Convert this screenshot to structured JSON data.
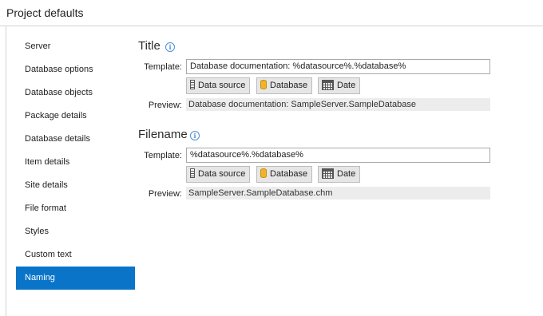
{
  "window": {
    "title": "Project defaults"
  },
  "sidebar": {
    "items": [
      {
        "label": "Server"
      },
      {
        "label": "Database options"
      },
      {
        "label": "Database objects"
      },
      {
        "label": "Package details"
      },
      {
        "label": "Database details"
      },
      {
        "label": "Item details"
      },
      {
        "label": "Site details"
      },
      {
        "label": "File format"
      },
      {
        "label": "Styles"
      },
      {
        "label": "Custom text"
      },
      {
        "label": "Naming",
        "selected": true
      }
    ]
  },
  "title_section": {
    "heading": "Title",
    "template_label": "Template:",
    "template_value": "Database documentation: %datasource%.%database%",
    "buttons": {
      "data_source": "Data source",
      "database": "Database",
      "date": "Date"
    },
    "preview_label": "Preview:",
    "preview_value": "Database documentation: SampleServer.SampleDatabase"
  },
  "filename_section": {
    "heading": "Filename",
    "template_label": "Template:",
    "template_value": "%datasource%.%database%",
    "buttons": {
      "data_source": "Data source",
      "database": "Database",
      "date": "Date"
    },
    "preview_label": "Preview:",
    "preview_value": "SampleServer.SampleDatabase.chm"
  },
  "icons": {
    "info": "info-icon",
    "data_source": "server-icon",
    "database": "database-icon",
    "date": "calendar-icon"
  },
  "colors": {
    "selected": "#0a74c9",
    "info": "#4d8fd6"
  }
}
